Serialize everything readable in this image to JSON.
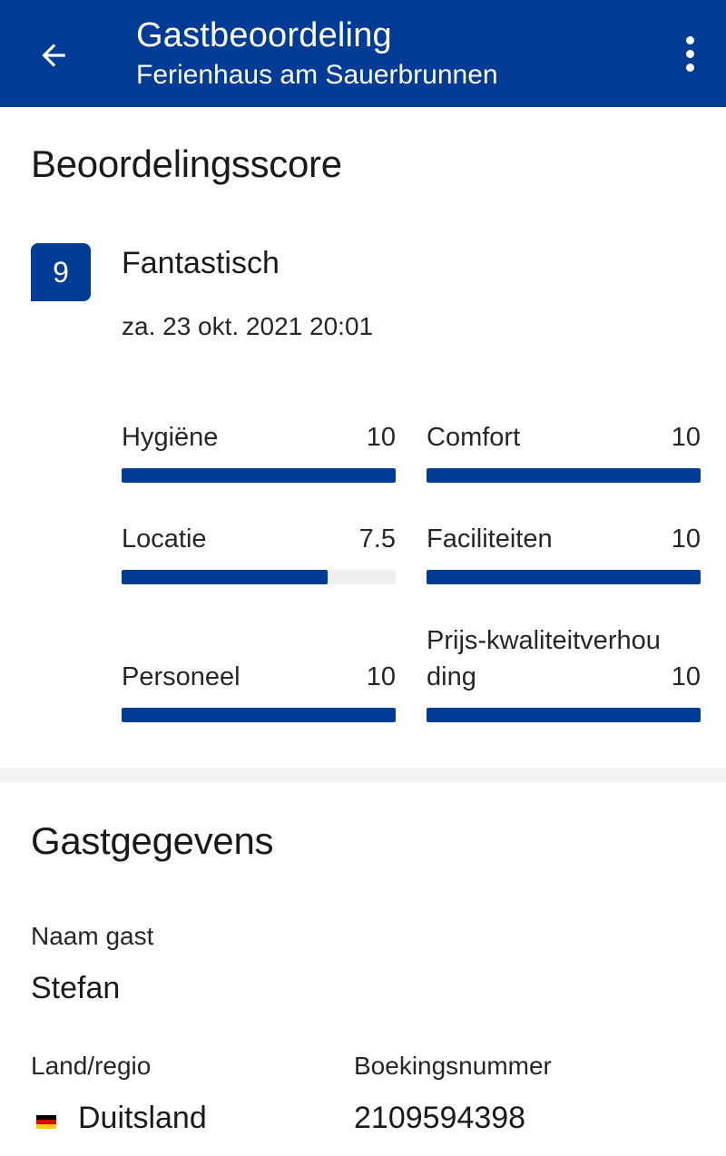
{
  "header": {
    "title": "Gastbeoordeling",
    "subtitle": "Ferienhaus am Sauerbrunnen",
    "back_icon": "arrow-left-icon",
    "menu_icon": "more-vertical-icon"
  },
  "rating": {
    "section_title": "Beoordelingsscore",
    "score": "9",
    "score_word": "Fantastisch",
    "date": "za. 23 okt. 2021 20:01",
    "categories": [
      {
        "label": "Hygiëne",
        "value": "10",
        "fraction": 1.0
      },
      {
        "label": "Comfort",
        "value": "10",
        "fraction": 1.0
      },
      {
        "label": "Locatie",
        "value": "7.5",
        "fraction": 0.75
      },
      {
        "label": "Faciliteiten",
        "value": "10",
        "fraction": 1.0
      },
      {
        "label": "Personeel",
        "value": "10",
        "fraction": 1.0
      },
      {
        "label": "Prijs-kwaliteitverhouding",
        "value": "10",
        "fraction": 1.0
      }
    ]
  },
  "guest": {
    "section_title": "Gastgegevens",
    "name_label": "Naam gast",
    "name_value": "Stefan",
    "country_label": "Land/regio",
    "country_value": "Duitsland",
    "country_flag_icon": "germany-flag-icon",
    "booking_label": "Boekingsnummer",
    "booking_value": "2109594398"
  },
  "colors": {
    "primary": "#003b95",
    "bar_track": "#eeeeee",
    "divider": "#f2f2f2"
  }
}
